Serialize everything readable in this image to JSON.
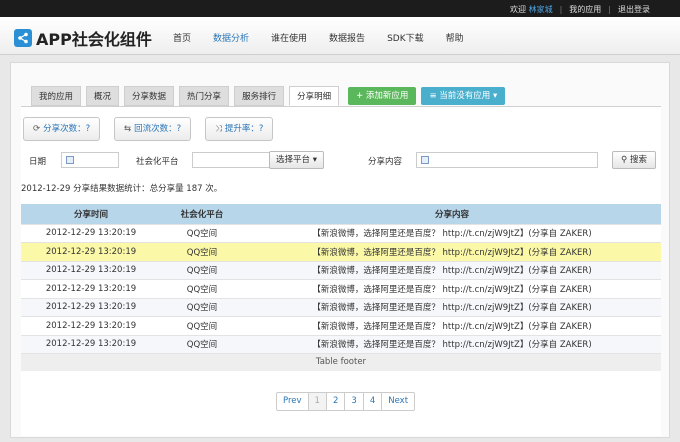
{
  "topbar": {
    "welcome": "欢迎",
    "username": "林家城",
    "my_apps": "我的应用",
    "logout": "退出登录"
  },
  "header": {
    "logo": "APP社会化组件",
    "nav": [
      "首页",
      "数据分析",
      "谁在使用",
      "数据报告",
      "SDK下载",
      "帮助"
    ],
    "active_nav": "数据分析"
  },
  "tabs": [
    "我的应用",
    "概况",
    "分享数据",
    "热门分享",
    "服务排行",
    "分享明细"
  ],
  "active_tab": "分享明细",
  "buttons": {
    "add_app": "添加新应用",
    "current_app": "当前没有应用"
  },
  "metrics": [
    {
      "label": "分享次数：?"
    },
    {
      "label": "回流次数：?"
    },
    {
      "label": "提升率：?"
    }
  ],
  "filter": {
    "date_label": "日期",
    "platform_label": "社会化平台",
    "platform_select": "选择平台",
    "content_label": "分享内容",
    "search": "搜索"
  },
  "summary": "2012-12-29 分享结果数据统计：总分享量 187 次。",
  "table": {
    "headers": [
      "分享时间",
      "社会化平台",
      "分享内容"
    ],
    "rows": [
      [
        "2012-12-29 13:20:19",
        "QQ空间",
        "【新浪微博，选择阿里还是百度？ http://t.cn/zjW9JtZ】(分享自 ZAKER)"
      ],
      [
        "2012-12-29 13:20:19",
        "QQ空间",
        "【新浪微博，选择阿里还是百度？ http://t.cn/zjW9JtZ】(分享自 ZAKER)"
      ],
      [
        "2012-12-29 13:20:19",
        "QQ空间",
        "【新浪微博，选择阿里还是百度？ http://t.cn/zjW9JtZ】(分享自 ZAKER)"
      ],
      [
        "2012-12-29 13:20:19",
        "QQ空间",
        "【新浪微博，选择阿里还是百度？ http://t.cn/zjW9JtZ】(分享自 ZAKER)"
      ],
      [
        "2012-12-29 13:20:19",
        "QQ空间",
        "【新浪微博，选择阿里还是百度？ http://t.cn/zjW9JtZ】(分享自 ZAKER)"
      ],
      [
        "2012-12-29 13:20:19",
        "QQ空间",
        "【新浪微博，选择阿里还是百度？ http://t.cn/zjW9JtZ】(分享自 ZAKER)"
      ],
      [
        "2012-12-29 13:20:19",
        "QQ空间",
        "【新浪微博，选择阿里还是百度？ http://t.cn/zjW9JtZ】(分享自 ZAKER)"
      ]
    ],
    "footer": "Table footer"
  },
  "pagination": [
    "Prev",
    "1",
    "2",
    "3",
    "4",
    "Next"
  ]
}
